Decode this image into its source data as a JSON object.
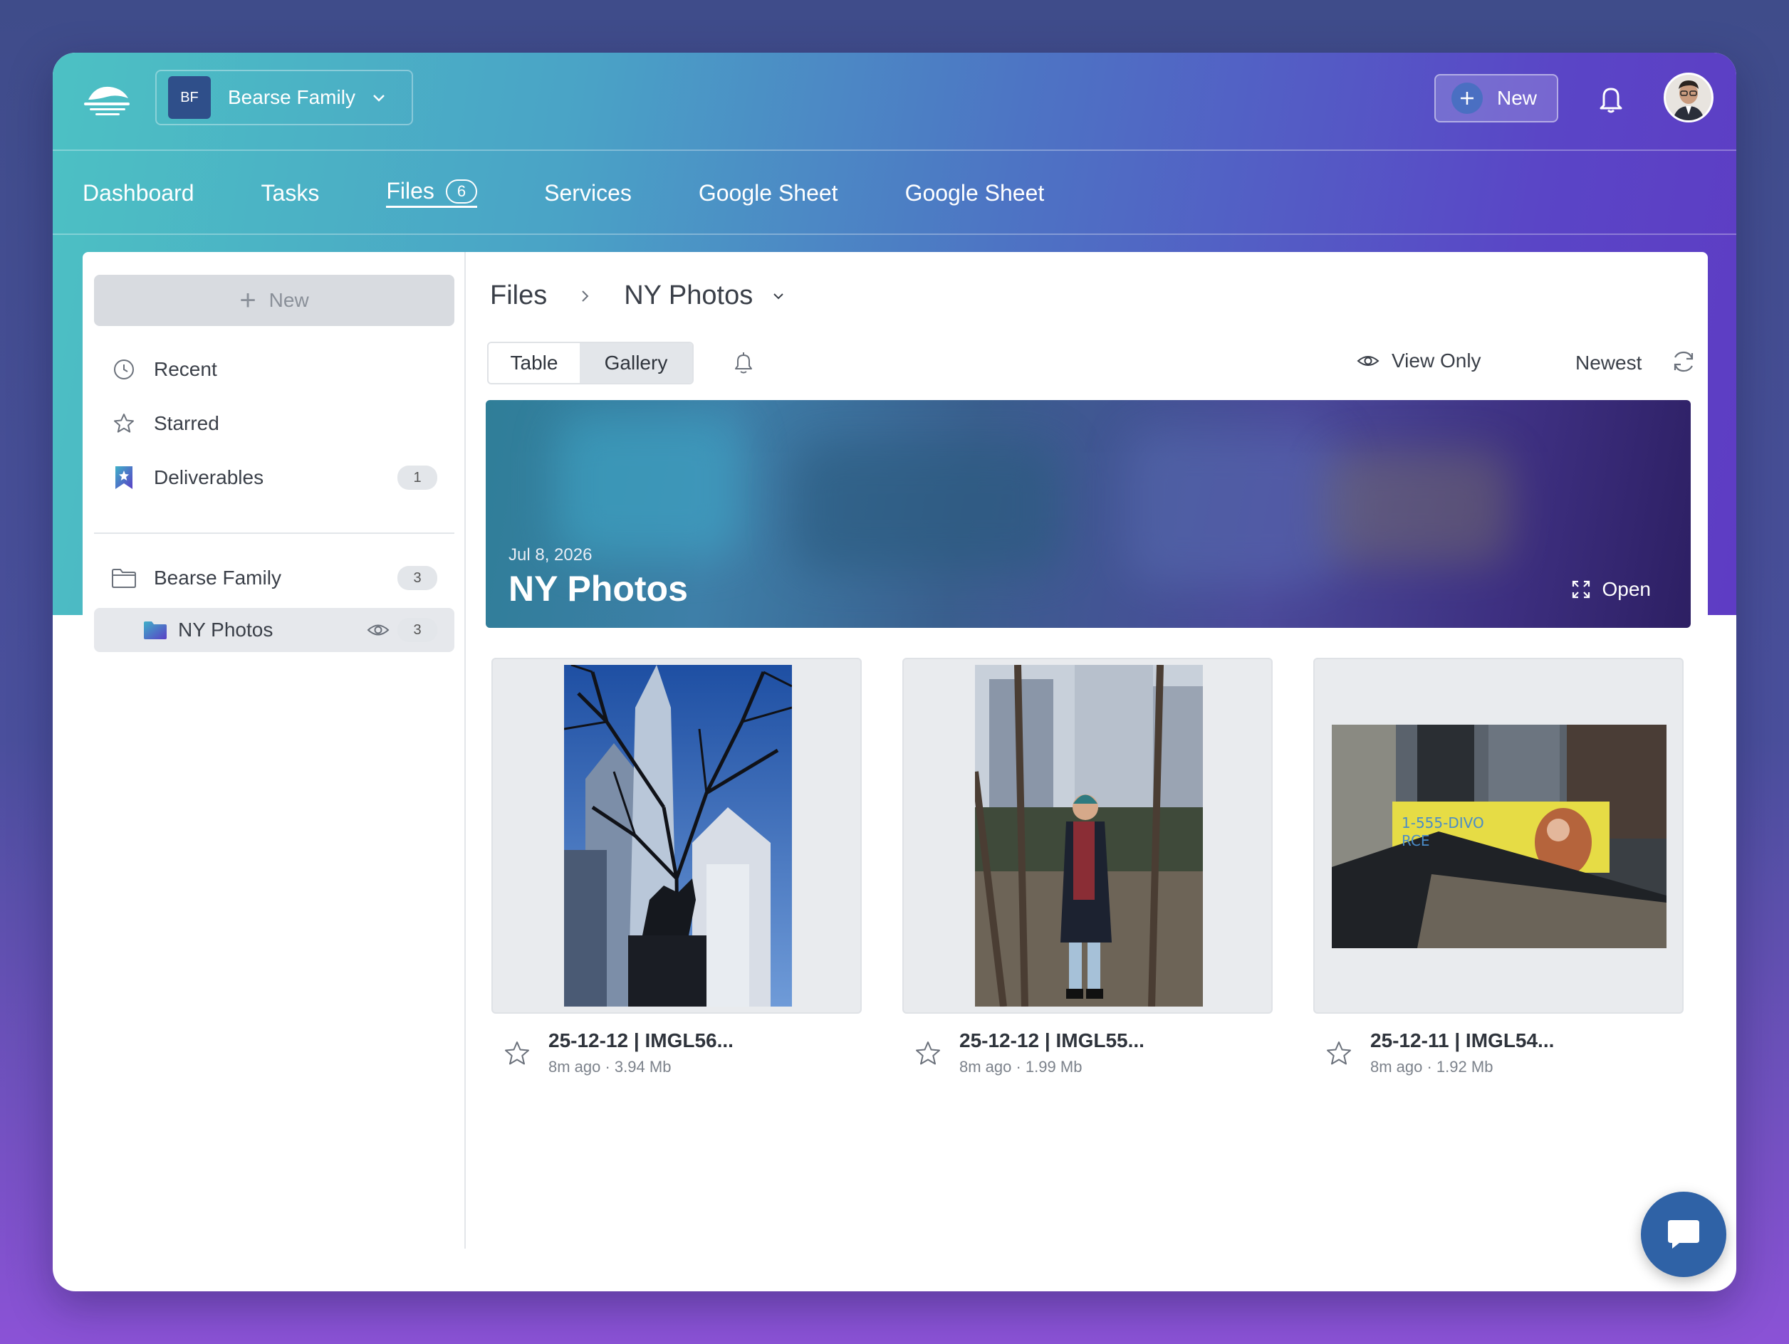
{
  "workspace": {
    "initials": "BF",
    "name": "Bearse Family"
  },
  "topbar": {
    "new_label": "New"
  },
  "nav": {
    "items": [
      {
        "label": "Dashboard"
      },
      {
        "label": "Tasks"
      },
      {
        "label": "Files",
        "count": "6"
      },
      {
        "label": "Services"
      },
      {
        "label": "Google Sheet"
      },
      {
        "label": "Google Sheet"
      }
    ]
  },
  "sidebar": {
    "new_label": "New",
    "items": [
      {
        "label": "Recent",
        "icon": "clock-icon"
      },
      {
        "label": "Starred",
        "icon": "star-icon"
      },
      {
        "label": "Deliverables",
        "icon": "bookmark-star-icon",
        "count": "1"
      }
    ],
    "folders": [
      {
        "label": "Bearse Family",
        "icon": "folder-icon",
        "count": "3"
      },
      {
        "label": "NY Photos",
        "icon": "folder-filled-icon",
        "count": "3"
      }
    ]
  },
  "main": {
    "breadcrumb": {
      "root": "Files",
      "current": "NY Photos"
    },
    "view_toggle": {
      "table": "Table",
      "gallery": "Gallery",
      "selected": "Gallery"
    },
    "view_only_label": "View Only",
    "sort_label": "Newest",
    "banner": {
      "date": "Jul 8, 2026",
      "title": "NY Photos",
      "open_label": "Open"
    },
    "files": [
      {
        "name": "25-12-12 | IMGL56...",
        "meta": "8m ago · 3.94 Mb"
      },
      {
        "name": "25-12-12 | IMGL55...",
        "meta": "8m ago · 1.99 Mb"
      },
      {
        "name": "25-12-11 | IMGL54...",
        "meta": "8m ago · 1.92 Mb",
        "billboard_text_1": "1-555-DIVO",
        "billboard_text_2": "RCE"
      }
    ]
  },
  "colors": {
    "accent": "#2f62a6",
    "gradient_start": "#4cc1c4",
    "gradient_end": "#5e3cc4"
  }
}
